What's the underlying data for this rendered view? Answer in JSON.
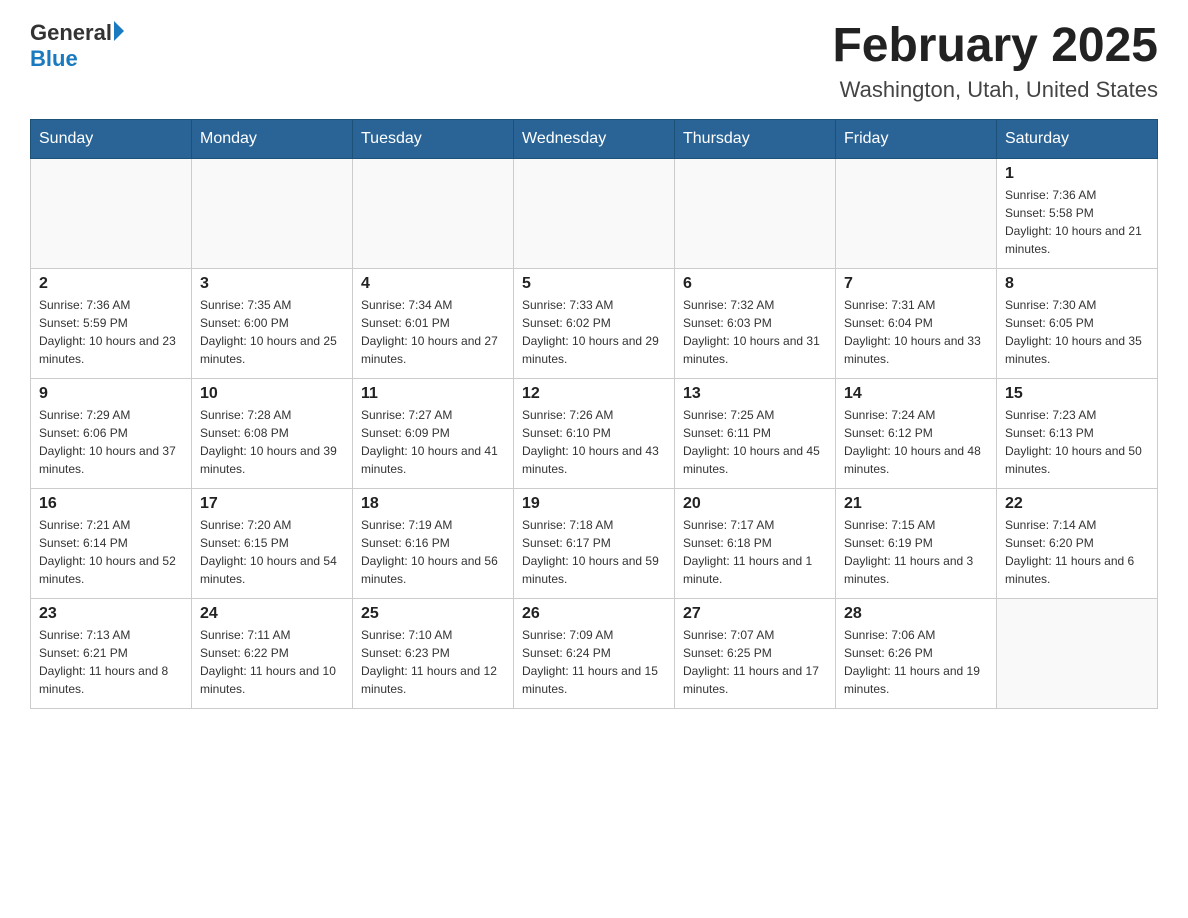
{
  "logo": {
    "text_general": "General",
    "text_blue": "Blue"
  },
  "title": "February 2025",
  "subtitle": "Washington, Utah, United States",
  "days_of_week": [
    "Sunday",
    "Monday",
    "Tuesday",
    "Wednesday",
    "Thursday",
    "Friday",
    "Saturday"
  ],
  "weeks": [
    [
      {
        "day": "",
        "sunrise": "",
        "sunset": "",
        "daylight": ""
      },
      {
        "day": "",
        "sunrise": "",
        "sunset": "",
        "daylight": ""
      },
      {
        "day": "",
        "sunrise": "",
        "sunset": "",
        "daylight": ""
      },
      {
        "day": "",
        "sunrise": "",
        "sunset": "",
        "daylight": ""
      },
      {
        "day": "",
        "sunrise": "",
        "sunset": "",
        "daylight": ""
      },
      {
        "day": "",
        "sunrise": "",
        "sunset": "",
        "daylight": ""
      },
      {
        "day": "1",
        "sunrise": "Sunrise: 7:36 AM",
        "sunset": "Sunset: 5:58 PM",
        "daylight": "Daylight: 10 hours and 21 minutes."
      }
    ],
    [
      {
        "day": "2",
        "sunrise": "Sunrise: 7:36 AM",
        "sunset": "Sunset: 5:59 PM",
        "daylight": "Daylight: 10 hours and 23 minutes."
      },
      {
        "day": "3",
        "sunrise": "Sunrise: 7:35 AM",
        "sunset": "Sunset: 6:00 PM",
        "daylight": "Daylight: 10 hours and 25 minutes."
      },
      {
        "day": "4",
        "sunrise": "Sunrise: 7:34 AM",
        "sunset": "Sunset: 6:01 PM",
        "daylight": "Daylight: 10 hours and 27 minutes."
      },
      {
        "day": "5",
        "sunrise": "Sunrise: 7:33 AM",
        "sunset": "Sunset: 6:02 PM",
        "daylight": "Daylight: 10 hours and 29 minutes."
      },
      {
        "day": "6",
        "sunrise": "Sunrise: 7:32 AM",
        "sunset": "Sunset: 6:03 PM",
        "daylight": "Daylight: 10 hours and 31 minutes."
      },
      {
        "day": "7",
        "sunrise": "Sunrise: 7:31 AM",
        "sunset": "Sunset: 6:04 PM",
        "daylight": "Daylight: 10 hours and 33 minutes."
      },
      {
        "day": "8",
        "sunrise": "Sunrise: 7:30 AM",
        "sunset": "Sunset: 6:05 PM",
        "daylight": "Daylight: 10 hours and 35 minutes."
      }
    ],
    [
      {
        "day": "9",
        "sunrise": "Sunrise: 7:29 AM",
        "sunset": "Sunset: 6:06 PM",
        "daylight": "Daylight: 10 hours and 37 minutes."
      },
      {
        "day": "10",
        "sunrise": "Sunrise: 7:28 AM",
        "sunset": "Sunset: 6:08 PM",
        "daylight": "Daylight: 10 hours and 39 minutes."
      },
      {
        "day": "11",
        "sunrise": "Sunrise: 7:27 AM",
        "sunset": "Sunset: 6:09 PM",
        "daylight": "Daylight: 10 hours and 41 minutes."
      },
      {
        "day": "12",
        "sunrise": "Sunrise: 7:26 AM",
        "sunset": "Sunset: 6:10 PM",
        "daylight": "Daylight: 10 hours and 43 minutes."
      },
      {
        "day": "13",
        "sunrise": "Sunrise: 7:25 AM",
        "sunset": "Sunset: 6:11 PM",
        "daylight": "Daylight: 10 hours and 45 minutes."
      },
      {
        "day": "14",
        "sunrise": "Sunrise: 7:24 AM",
        "sunset": "Sunset: 6:12 PM",
        "daylight": "Daylight: 10 hours and 48 minutes."
      },
      {
        "day": "15",
        "sunrise": "Sunrise: 7:23 AM",
        "sunset": "Sunset: 6:13 PM",
        "daylight": "Daylight: 10 hours and 50 minutes."
      }
    ],
    [
      {
        "day": "16",
        "sunrise": "Sunrise: 7:21 AM",
        "sunset": "Sunset: 6:14 PM",
        "daylight": "Daylight: 10 hours and 52 minutes."
      },
      {
        "day": "17",
        "sunrise": "Sunrise: 7:20 AM",
        "sunset": "Sunset: 6:15 PM",
        "daylight": "Daylight: 10 hours and 54 minutes."
      },
      {
        "day": "18",
        "sunrise": "Sunrise: 7:19 AM",
        "sunset": "Sunset: 6:16 PM",
        "daylight": "Daylight: 10 hours and 56 minutes."
      },
      {
        "day": "19",
        "sunrise": "Sunrise: 7:18 AM",
        "sunset": "Sunset: 6:17 PM",
        "daylight": "Daylight: 10 hours and 59 minutes."
      },
      {
        "day": "20",
        "sunrise": "Sunrise: 7:17 AM",
        "sunset": "Sunset: 6:18 PM",
        "daylight": "Daylight: 11 hours and 1 minute."
      },
      {
        "day": "21",
        "sunrise": "Sunrise: 7:15 AM",
        "sunset": "Sunset: 6:19 PM",
        "daylight": "Daylight: 11 hours and 3 minutes."
      },
      {
        "day": "22",
        "sunrise": "Sunrise: 7:14 AM",
        "sunset": "Sunset: 6:20 PM",
        "daylight": "Daylight: 11 hours and 6 minutes."
      }
    ],
    [
      {
        "day": "23",
        "sunrise": "Sunrise: 7:13 AM",
        "sunset": "Sunset: 6:21 PM",
        "daylight": "Daylight: 11 hours and 8 minutes."
      },
      {
        "day": "24",
        "sunrise": "Sunrise: 7:11 AM",
        "sunset": "Sunset: 6:22 PM",
        "daylight": "Daylight: 11 hours and 10 minutes."
      },
      {
        "day": "25",
        "sunrise": "Sunrise: 7:10 AM",
        "sunset": "Sunset: 6:23 PM",
        "daylight": "Daylight: 11 hours and 12 minutes."
      },
      {
        "day": "26",
        "sunrise": "Sunrise: 7:09 AM",
        "sunset": "Sunset: 6:24 PM",
        "daylight": "Daylight: 11 hours and 15 minutes."
      },
      {
        "day": "27",
        "sunrise": "Sunrise: 7:07 AM",
        "sunset": "Sunset: 6:25 PM",
        "daylight": "Daylight: 11 hours and 17 minutes."
      },
      {
        "day": "28",
        "sunrise": "Sunrise: 7:06 AM",
        "sunset": "Sunset: 6:26 PM",
        "daylight": "Daylight: 11 hours and 19 minutes."
      },
      {
        "day": "",
        "sunrise": "",
        "sunset": "",
        "daylight": ""
      }
    ]
  ]
}
